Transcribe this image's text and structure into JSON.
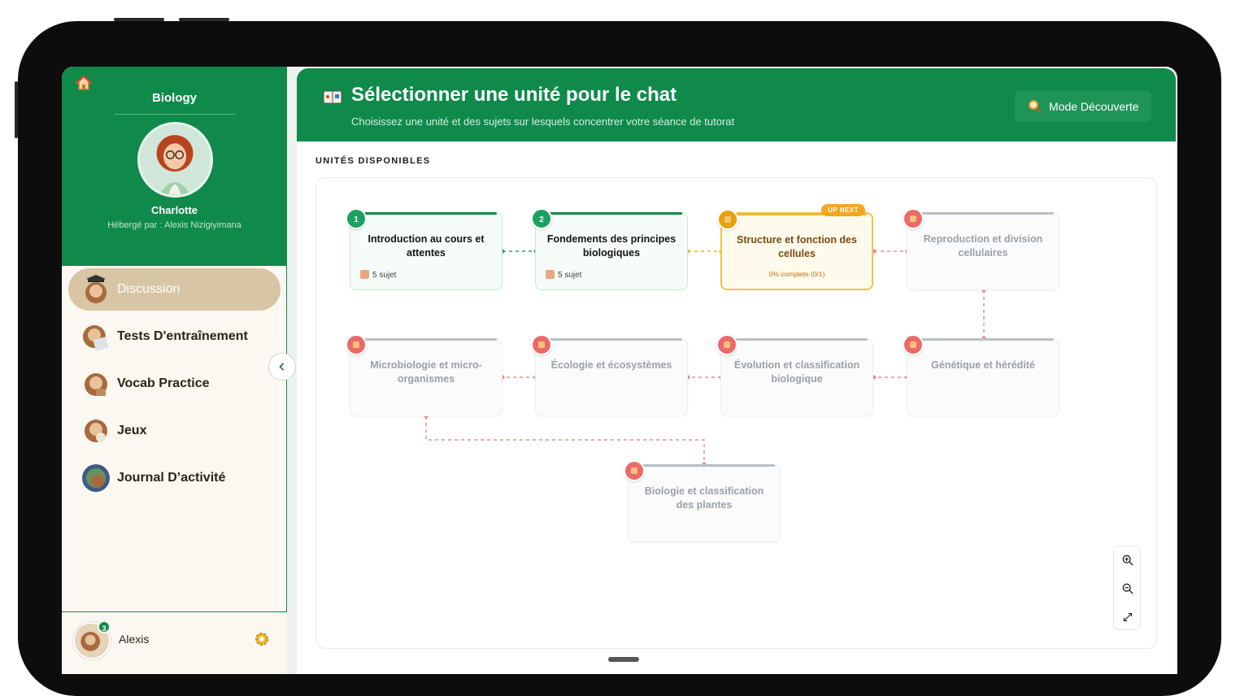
{
  "sidebar": {
    "subject": "Biology",
    "tutor_name": "Charlotte",
    "tutor_host": "Hébergé par : Alexis Nizigiyimana",
    "menu": [
      {
        "label": "Discussion",
        "active": true
      },
      {
        "label": "Tests D'entraînement",
        "active": false
      },
      {
        "label": "Vocab Practice",
        "active": false
      },
      {
        "label": "Jeux",
        "active": false
      },
      {
        "label": "Journal D’activité",
        "active": false
      }
    ],
    "user": {
      "name": "Alexis",
      "badge": "3"
    }
  },
  "header": {
    "title": "Sélectionner une unité pour le chat",
    "subtitle": "Choisissez une unité et des sujets sur lesquels concentrer votre séance de tutorat",
    "discover_button": "Mode Découverte"
  },
  "section_label": "UNITÉS DISPONIBLES",
  "units": [
    {
      "num": "1",
      "title": "Introduction au cours et attentes",
      "meta": "5 sujet",
      "status": "done"
    },
    {
      "num": "2",
      "title": "Fondements des principes biologiques",
      "meta": "5 sujet",
      "status": "done"
    },
    {
      "num": "",
      "title": "Structure et fonction des cellules",
      "progress": "0% complete (0/1)",
      "tag": "UP NEXT",
      "status": "next"
    },
    {
      "num": "",
      "title": "Reproduction et division cellulaires",
      "status": "locked"
    },
    {
      "num": "",
      "title": "Génétique et hérédité",
      "status": "locked"
    },
    {
      "num": "",
      "title": "Évolution et classification biologique",
      "status": "locked"
    },
    {
      "num": "",
      "title": "Écologie et écosystèmes",
      "status": "locked"
    },
    {
      "num": "",
      "title": "Microbiologie et micro-organismes",
      "status": "locked"
    },
    {
      "num": "",
      "title": "Biologie et classification des plantes",
      "status": "locked"
    }
  ],
  "colors": {
    "brand": "#0f8a4a",
    "next": "#f2b630",
    "locked": "#ea6a6a",
    "active_menu": "#d8c5a5"
  }
}
